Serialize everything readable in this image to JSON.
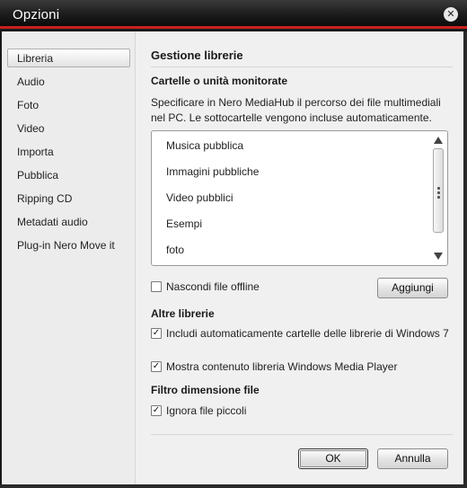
{
  "window": {
    "title": "Opzioni",
    "close_glyph": "✕",
    "accent_color": "#c8201e"
  },
  "sidebar": {
    "items": [
      {
        "label": "Libreria",
        "selected": true
      },
      {
        "label": "Audio",
        "selected": false
      },
      {
        "label": "Foto",
        "selected": false
      },
      {
        "label": "Video",
        "selected": false
      },
      {
        "label": "Importa",
        "selected": false
      },
      {
        "label": "Pubblica",
        "selected": false
      },
      {
        "label": "Ripping CD",
        "selected": false
      },
      {
        "label": "Metadati audio",
        "selected": false
      },
      {
        "label": "Plug-in Nero Move it",
        "selected": false
      }
    ]
  },
  "main": {
    "heading": "Gestione librerie",
    "monitored": {
      "heading": "Cartelle o unità monitorate",
      "description": "Specificare in Nero MediaHub il percorso dei file multimediali nel PC. Le sottocartelle vengono incluse automaticamente.",
      "folders": [
        "Musica pubblica",
        "Immagini pubbliche",
        "Video pubblici",
        "Esempi",
        "foto"
      ]
    },
    "hide_offline": {
      "label": "Nascondi file offline",
      "checked": false
    },
    "add_button": "Aggiungi",
    "other_libraries": {
      "heading": "Altre librerie",
      "options": [
        {
          "label": "Includi automaticamente cartelle delle librerie di Windows 7",
          "checked": true
        },
        {
          "label": "Mostra contenuto libreria Windows Media Player",
          "checked": true
        }
      ]
    },
    "file_size_filter": {
      "heading": "Filtro dimensione file",
      "option": {
        "label": "Ignora file piccoli",
        "checked": true
      }
    }
  },
  "footer": {
    "ok_label": "OK",
    "cancel_label": "Annulla"
  }
}
